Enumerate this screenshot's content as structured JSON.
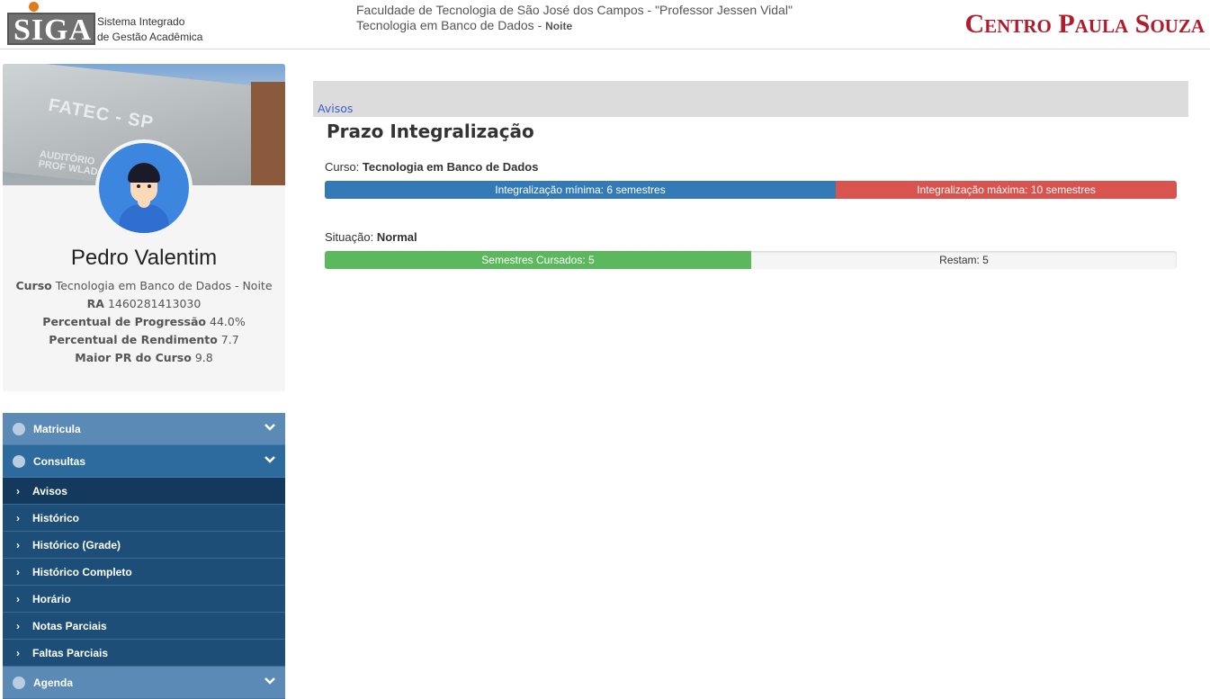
{
  "header": {
    "logo_text": "SIGA",
    "logo_subtitle_1": "Sistema Integrado",
    "logo_subtitle_2": "de Gestão Acadêmica",
    "institution": "Faculdade de Tecnologia de São José dos Campos - \"Professor Jessen Vidal\"",
    "course": "Tecnologia em Banco de Dados",
    "separator": "-",
    "shift": "Noite",
    "brand": "Centro Paula Souza",
    "brand_color": "#b01c2c"
  },
  "profile": {
    "cover_text": "FATEC - SP",
    "cover_subtext_1": "AUDITÓRIO",
    "cover_subtext_2": "PROF WLAD",
    "name": "Pedro Valentim",
    "curso_label": "Curso",
    "curso_value": "Tecnologia em Banco de Dados - Noite",
    "ra_label": "RA",
    "ra_value": "1460281413030",
    "progressao_label": "Percentual de Progressão",
    "progressao_value": "44.0%",
    "rendimento_label": "Percentual de Rendimento",
    "rendimento_value": "7.7",
    "maior_pr_label": "Maior PR do Curso",
    "maior_pr_value": "9.8"
  },
  "menu": {
    "matricula": "Matricula",
    "consultas": "Consultas",
    "items": [
      "Avisos",
      "Histórico",
      "Histórico (Grade)",
      "Histórico Completo",
      "Horário",
      "Notas Parciais",
      "Faltas Parciais"
    ],
    "agenda": "Agenda"
  },
  "breadcrumb": {
    "link": "Avisos"
  },
  "main": {
    "title": "Prazo Integralização",
    "curso_label": "Curso:",
    "curso_value": "Tecnologia em Banco de Dados",
    "min_label": "Integralização mínima: 6 semestres",
    "max_label": "Integralização máxima: 10 semestres",
    "min_semesters": 6,
    "max_semesters": 10,
    "situacao_label": "Situação:",
    "situacao_value": "Normal",
    "cursados_label": "Semestres Cursados: 5",
    "restam_label": "Restam: 5",
    "cursados": 5,
    "restam": 5,
    "colors": {
      "min": "#337ab7",
      "max": "#d9534f",
      "cursados": "#5cb85c"
    }
  }
}
